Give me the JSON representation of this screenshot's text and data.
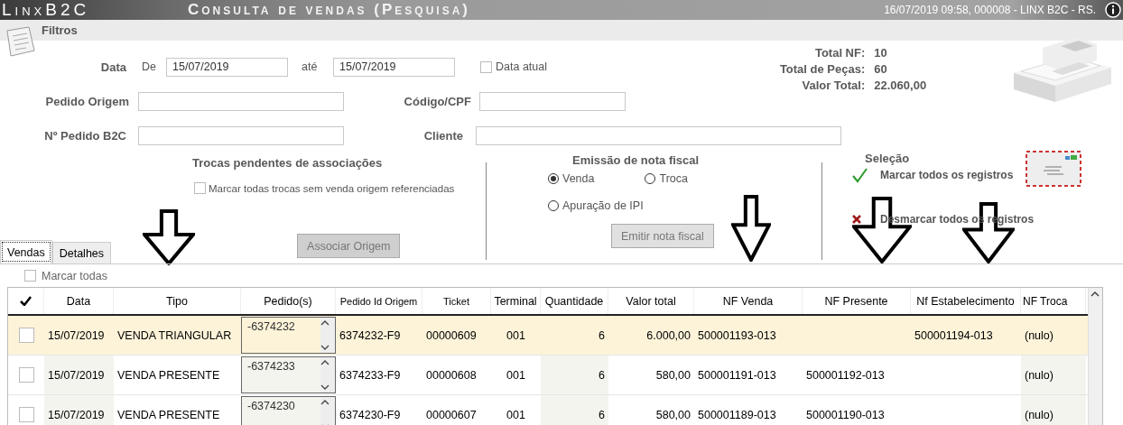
{
  "window": {
    "app_name": "LinxB2C",
    "title": "Consulta de vendas (Pesquisa)",
    "status": "16/07/2019 09:58, 000008 - LINX B2C - RS."
  },
  "filters": {
    "title": "Filtros",
    "date": {
      "label": "Data",
      "from_label": "De",
      "from": "15/07/2019",
      "to_label": "até",
      "to": "15/07/2019",
      "current_label": "Data atual",
      "current_checked": false
    },
    "fields": [
      {
        "label": "Pedido Origem"
      },
      {
        "label": "Código/CPF"
      },
      {
        "label": "Nº Pedido B2C"
      },
      {
        "label": "Cliente"
      }
    ],
    "totals": [
      {
        "label": "Total NF:",
        "value": "10"
      },
      {
        "label": "Total de Peças:",
        "value": "60"
      },
      {
        "label": "Valor Total:",
        "value": "22.060,00"
      }
    ]
  },
  "pending": {
    "title": "Trocas pendentes de associações",
    "check_label": "Marcar todas trocas sem venda origem referenciadas",
    "checked": false,
    "button": "Associar Origem"
  },
  "emission": {
    "title": "Emissão de nota fiscal",
    "options": [
      {
        "label": "Venda",
        "selected": true
      },
      {
        "label": "Troca",
        "selected": false
      },
      {
        "label": "Apuração de IPI",
        "selected": false
      }
    ],
    "button": "Emitir nota fiscal"
  },
  "selection": {
    "title": "Seleção",
    "mark_all": "Marcar todos os registros",
    "unmark_all": "Desmarcar todos os registros"
  },
  "tabs": [
    {
      "label": "Vendas",
      "selected": true
    },
    {
      "label": "Detalhes",
      "selected": false
    }
  ],
  "mark_all": {
    "label": "Marcar todas",
    "checked": false
  },
  "table": {
    "columns": [
      "Data",
      "Tipo",
      "Pedido(s)",
      "Pedido Id Origem",
      "Ticket",
      "Terminal",
      "Quantidade",
      "Valor total",
      "NF Venda",
      "NF Presente",
      "Nf Estabelecimento",
      "NF Troca"
    ],
    "rows": [
      {
        "selected": true,
        "checked": false,
        "cells": [
          "15/07/2019",
          "VENDA TRIANGULAR",
          "-6374232",
          "6374232-F9",
          "00000609",
          "001",
          "6",
          "6.000,00",
          "500001193-013",
          "",
          "500001194-013",
          "(nulo)"
        ]
      },
      {
        "selected": false,
        "checked": false,
        "cells": [
          "15/07/2019",
          "VENDA PRESENTE",
          "-6374233",
          "6374233-F9",
          "00000608",
          "001",
          "6",
          "580,00",
          "500001191-013",
          "500001192-013",
          "",
          "(nulo)"
        ]
      },
      {
        "selected": false,
        "checked": false,
        "cells": [
          "15/07/2019",
          "VENDA PRESENTE",
          "-6374230",
          "6374230-F9",
          "00000607",
          "001",
          "6",
          "580,00",
          "500001189-013",
          "500001190-013",
          "",
          "(nulo)"
        ]
      }
    ]
  }
}
